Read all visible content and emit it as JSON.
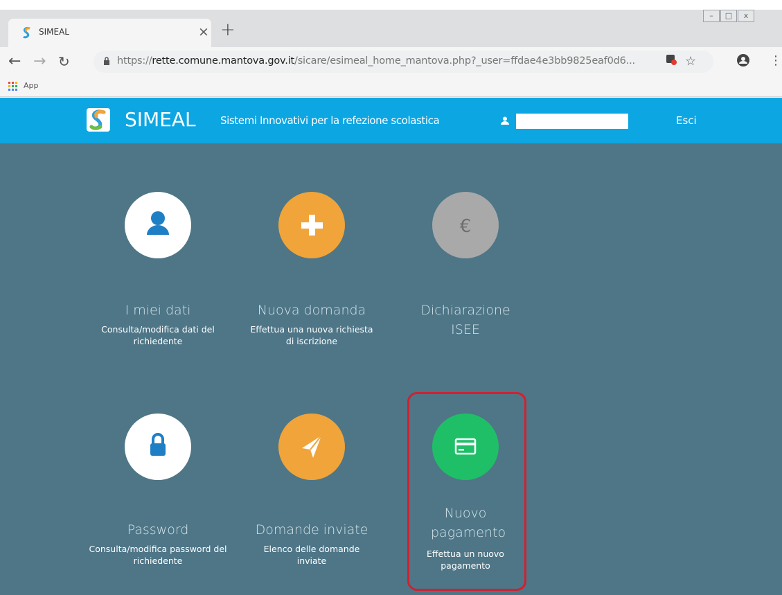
{
  "browser": {
    "tab_title": "SIMEAL",
    "url_host_prefix": "https://",
    "url_host": "rette.comune.mantova.gov.it",
    "url_path": "/sicare/esimeal_home_mantova.php?_user=ffdae4e3bb9825eaf0d6...",
    "bookmarks_apps_label": "App"
  },
  "header": {
    "brand": "SIMEAL",
    "tagline": "Sistemi Innovativi per la refezione scolastica",
    "logout": "Esci"
  },
  "tiles": [
    {
      "title": "I miei dati",
      "desc": "Consulta/modifica dati del richiedente",
      "icon": "user-icon",
      "color": "#ffffff"
    },
    {
      "title": "Nuova domanda",
      "desc": "Effettua una nuova richiesta di iscrizione",
      "icon": "plus-icon",
      "color": "#f0a43a"
    },
    {
      "title": "Dichiarazione ISEE",
      "desc": "",
      "icon": "euro-icon",
      "color": "#a9a9a9"
    },
    {
      "title": "Password",
      "desc": "Consulta/modifica password del richiedente",
      "icon": "lock-icon",
      "color": "#ffffff"
    },
    {
      "title": "Domande inviate",
      "desc": "Elenco delle domande inviate",
      "icon": "paper-plane-icon",
      "color": "#f0a43a"
    },
    {
      "title": "Nuovo pagamento",
      "desc": "Effettua un nuovo pagamento",
      "icon": "credit-card-icon",
      "color": "#1fbf67"
    }
  ],
  "colors": {
    "header_bg": "#0ca6e3",
    "page_bg": "#4e7687",
    "highlight": "#cf2132"
  }
}
